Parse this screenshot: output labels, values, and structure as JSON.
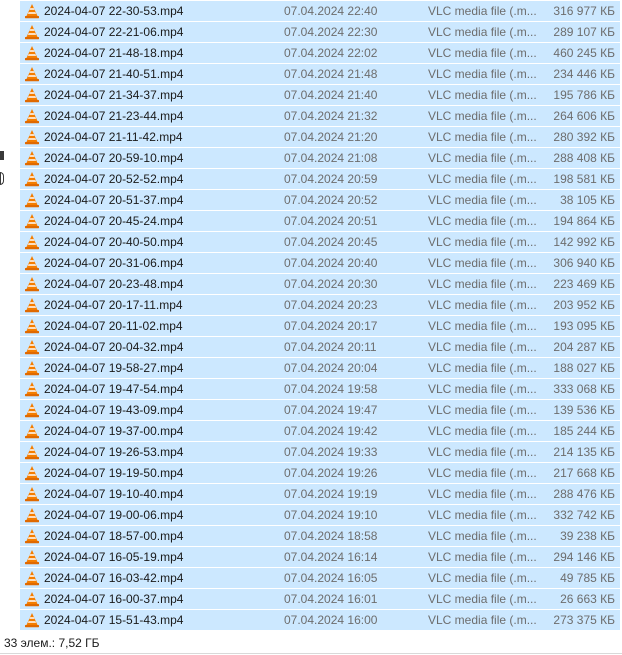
{
  "files": [
    {
      "name": "2024-04-07 22-30-53.mp4",
      "date": "07.04.2024 22:40",
      "type": "VLC media file (.m...",
      "size": "316 977 КБ",
      "icon": "vlc-cone-icon"
    },
    {
      "name": "2024-04-07 22-21-06.mp4",
      "date": "07.04.2024 22:30",
      "type": "VLC media file (.m...",
      "size": "289 107 КБ",
      "icon": "vlc-cone-icon"
    },
    {
      "name": "2024-04-07 21-48-18.mp4",
      "date": "07.04.2024 22:02",
      "type": "VLC media file (.m...",
      "size": "460 245 КБ",
      "icon": "vlc-cone-icon"
    },
    {
      "name": "2024-04-07 21-40-51.mp4",
      "date": "07.04.2024 21:48",
      "type": "VLC media file (.m...",
      "size": "234 446 КБ",
      "icon": "vlc-cone-icon"
    },
    {
      "name": "2024-04-07 21-34-37.mp4",
      "date": "07.04.2024 21:40",
      "type": "VLC media file (.m...",
      "size": "195 786 КБ",
      "icon": "vlc-cone-icon"
    },
    {
      "name": "2024-04-07 21-23-44.mp4",
      "date": "07.04.2024 21:32",
      "type": "VLC media file (.m...",
      "size": "264 606 КБ",
      "icon": "vlc-cone-icon"
    },
    {
      "name": "2024-04-07 21-11-42.mp4",
      "date": "07.04.2024 21:20",
      "type": "VLC media file (.m...",
      "size": "280 392 КБ",
      "icon": "vlc-cone-icon"
    },
    {
      "name": "2024-04-07 20-59-10.mp4",
      "date": "07.04.2024 21:08",
      "type": "VLC media file (.m...",
      "size": "288 408 КБ",
      "icon": "vlc-cone-icon"
    },
    {
      "name": "2024-04-07 20-52-52.mp4",
      "date": "07.04.2024 20:59",
      "type": "VLC media file (.m...",
      "size": "198 581 КБ",
      "icon": "vlc-cone-icon"
    },
    {
      "name": "2024-04-07 20-51-37.mp4",
      "date": "07.04.2024 20:52",
      "type": "VLC media file (.m...",
      "size": "38 105 КБ",
      "icon": "vlc-cone-icon"
    },
    {
      "name": "2024-04-07 20-45-24.mp4",
      "date": "07.04.2024 20:51",
      "type": "VLC media file (.m...",
      "size": "194 864 КБ",
      "icon": "vlc-cone-icon"
    },
    {
      "name": "2024-04-07 20-40-50.mp4",
      "date": "07.04.2024 20:45",
      "type": "VLC media file (.m...",
      "size": "142 992 КБ",
      "icon": "vlc-cone-icon"
    },
    {
      "name": "2024-04-07 20-31-06.mp4",
      "date": "07.04.2024 20:40",
      "type": "VLC media file (.m...",
      "size": "306 940 КБ",
      "icon": "vlc-cone-icon"
    },
    {
      "name": "2024-04-07 20-23-48.mp4",
      "date": "07.04.2024 20:30",
      "type": "VLC media file (.m...",
      "size": "223 469 КБ",
      "icon": "vlc-cone-icon"
    },
    {
      "name": "2024-04-07 20-17-11.mp4",
      "date": "07.04.2024 20:23",
      "type": "VLC media file (.m...",
      "size": "203 952 КБ",
      "icon": "vlc-cone-icon"
    },
    {
      "name": "2024-04-07 20-11-02.mp4",
      "date": "07.04.2024 20:17",
      "type": "VLC media file (.m...",
      "size": "193 095 КБ",
      "icon": "vlc-cone-icon"
    },
    {
      "name": "2024-04-07 20-04-32.mp4",
      "date": "07.04.2024 20:11",
      "type": "VLC media file (.m...",
      "size": "204 287 КБ",
      "icon": "vlc-cone-icon"
    },
    {
      "name": "2024-04-07 19-58-27.mp4",
      "date": "07.04.2024 20:04",
      "type": "VLC media file (.m...",
      "size": "188 027 КБ",
      "icon": "vlc-cone-icon"
    },
    {
      "name": "2024-04-07 19-47-54.mp4",
      "date": "07.04.2024 19:58",
      "type": "VLC media file (.m...",
      "size": "333 068 КБ",
      "icon": "vlc-cone-icon"
    },
    {
      "name": "2024-04-07 19-43-09.mp4",
      "date": "07.04.2024 19:47",
      "type": "VLC media file (.m...",
      "size": "139 536 КБ",
      "icon": "vlc-cone-icon"
    },
    {
      "name": "2024-04-07 19-37-00.mp4",
      "date": "07.04.2024 19:42",
      "type": "VLC media file (.m...",
      "size": "185 244 КБ",
      "icon": "vlc-cone-icon"
    },
    {
      "name": "2024-04-07 19-26-53.mp4",
      "date": "07.04.2024 19:33",
      "type": "VLC media file (.m...",
      "size": "214 135 КБ",
      "icon": "vlc-cone-icon"
    },
    {
      "name": "2024-04-07 19-19-50.mp4",
      "date": "07.04.2024 19:26",
      "type": "VLC media file (.m...",
      "size": "217 668 КБ",
      "icon": "vlc-cone-icon"
    },
    {
      "name": "2024-04-07 19-10-40.mp4",
      "date": "07.04.2024 19:19",
      "type": "VLC media file (.m...",
      "size": "288 476 КБ",
      "icon": "vlc-cone-icon"
    },
    {
      "name": "2024-04-07 19-00-06.mp4",
      "date": "07.04.2024 19:10",
      "type": "VLC media file (.m...",
      "size": "332 742 КБ",
      "icon": "vlc-cone-icon"
    },
    {
      "name": "2024-04-07 18-57-00.mp4",
      "date": "07.04.2024 18:58",
      "type": "VLC media file (.m...",
      "size": "39 238 КБ",
      "icon": "vlc-cone-icon"
    },
    {
      "name": "2024-04-07 16-05-19.mp4",
      "date": "07.04.2024 16:14",
      "type": "VLC media file (.m...",
      "size": "294 146 КБ",
      "icon": "vlc-cone-icon"
    },
    {
      "name": "2024-04-07 16-03-42.mp4",
      "date": "07.04.2024 16:05",
      "type": "VLC media file (.m...",
      "size": "49 785 КБ",
      "icon": "vlc-cone-icon"
    },
    {
      "name": "2024-04-07 16-00-37.mp4",
      "date": "07.04.2024 16:01",
      "type": "VLC media file (.m...",
      "size": "26 663 КБ",
      "icon": "vlc-cone-icon"
    },
    {
      "name": "2024-04-07 15-51-43.mp4",
      "date": "07.04.2024 16:00",
      "type": "VLC media file (.m...",
      "size": "273 375 КБ",
      "icon": "vlc-cone-icon"
    }
  ],
  "status_bar": {
    "summary": "33 элем.: 7,52 ГБ"
  },
  "colors": {
    "selection": "#cce8ff",
    "vlc_orange": "#f47d00",
    "vlc_stripe": "#ffffff",
    "secondary_text": "#6d6d6d"
  }
}
